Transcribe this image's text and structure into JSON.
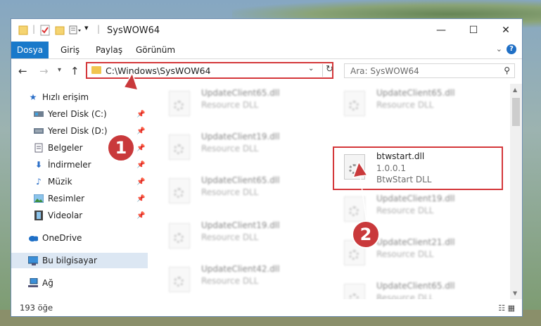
{
  "window": {
    "title": "SysWOW64",
    "controls": {
      "minimize": "—",
      "maximize": "☐",
      "close": "✕"
    }
  },
  "ribbon": {
    "tabs": [
      "Dosya",
      "Giriş",
      "Paylaş",
      "Görünüm"
    ]
  },
  "address": {
    "path": "C:\\Windows\\SysWOW64"
  },
  "search": {
    "placeholder": "Ara: SysWOW64"
  },
  "sidebar": {
    "items": [
      {
        "label": "Hızlı erişim",
        "icon": "star-icon"
      },
      {
        "label": "Yerel Disk (C:)",
        "icon": "drive-icon"
      },
      {
        "label": "Yerel Disk (D:)",
        "icon": "drive-icon"
      },
      {
        "label": "Belgeler",
        "icon": "documents-icon"
      },
      {
        "label": "İndirmeler",
        "icon": "download-icon"
      },
      {
        "label": "Müzik",
        "icon": "music-icon"
      },
      {
        "label": "Resimler",
        "icon": "pictures-icon"
      },
      {
        "label": "Videolar",
        "icon": "video-icon"
      },
      {
        "label": "OneDrive",
        "icon": "cloud-icon"
      },
      {
        "label": "Bu bilgisayar",
        "icon": "computer-icon"
      },
      {
        "label": "Ağ",
        "icon": "network-icon"
      }
    ]
  },
  "files": [
    {
      "name": "UpdateClient65.dll",
      "line2": "Resource DLL",
      "line3": ""
    },
    {
      "name": "UpdateClient65.dll",
      "line2": "Resource DLL",
      "line3": ""
    },
    {
      "name": "UpdateClient19.dll",
      "line2": "Resource DLL",
      "line3": ""
    },
    {
      "name": "btwstart.dll",
      "line2": "1.0.0.1",
      "line3": "BtwStart DLL"
    },
    {
      "name": "UpdateClient65.dll",
      "line2": "Resource DLL",
      "line3": ""
    },
    {
      "name": "UpdateClient19.dll",
      "line2": "Resource DLL",
      "line3": ""
    },
    {
      "name": "UpdateClient19.dll",
      "line2": "Resource DLL",
      "line3": ""
    },
    {
      "name": "UpdateClient21.dll",
      "line2": "Resource DLL",
      "line3": ""
    },
    {
      "name": "UpdateClient42.dll",
      "line2": "Resource DLL",
      "line3": ""
    },
    {
      "name": "UpdateClient65.dll",
      "line2": "Resource DLL",
      "line3": ""
    }
  ],
  "status": {
    "count": "193 öğe"
  },
  "annotations": {
    "step1": "1",
    "step2": "2",
    "color": "#c9393b"
  }
}
